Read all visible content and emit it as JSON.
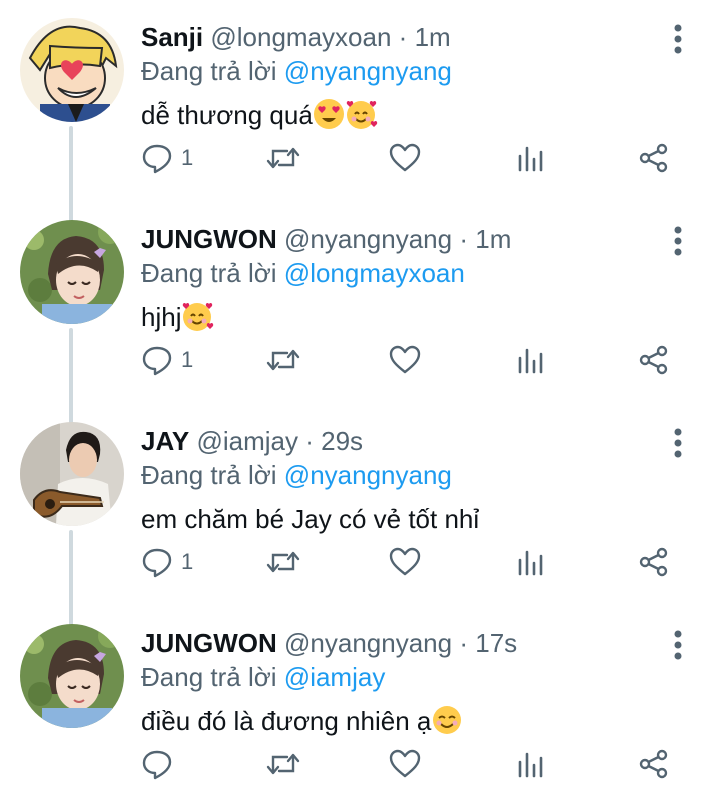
{
  "reply_prefix": "Đang trả lời",
  "tweets": [
    {
      "name": "Sanji",
      "handle": "@longmayxoan",
      "sep": "·",
      "time": "1m",
      "reply_to": "@longmayxoan",
      "reply_to_display": "@nyangnyang",
      "text": "dễ thương quá",
      "emojis": [
        "heart-eyes-emoji",
        "smiling-hearts-emoji"
      ],
      "reply_count": "1"
    },
    {
      "name": "JUNGWON",
      "handle": "@nyangnyang",
      "sep": "·",
      "time": "1m",
      "reply_to_display": "@longmayxoan",
      "text": "hjhj",
      "emojis": [
        "smiling-hearts-emoji"
      ],
      "reply_count": "1"
    },
    {
      "name": "JAY",
      "handle": "@iamjay",
      "sep": "·",
      "time": "29s",
      "reply_to_display": "@nyangnyang",
      "text": "em chăm bé Jay có vẻ tốt nhỉ",
      "emojis": [],
      "reply_count": "1"
    },
    {
      "name": "JUNGWON",
      "handle": "@nyangnyang",
      "sep": "·",
      "time": "17s",
      "reply_to_display": "@iamjay",
      "text": "điều đó là đương nhiên ạ",
      "emojis": [
        "smiling-face-emoji"
      ],
      "reply_count": ""
    }
  ],
  "colors": {
    "accent": "#1d9bf0",
    "secondary_text": "#536471",
    "thread_line": "#cfd9de"
  }
}
